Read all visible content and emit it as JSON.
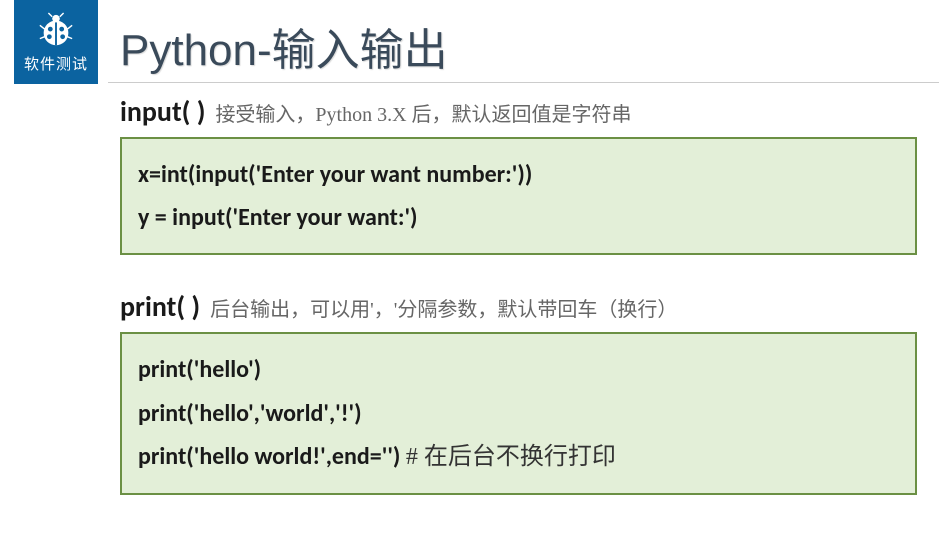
{
  "logo": {
    "text": "软件测试"
  },
  "title": "Python-输入输出",
  "section1": {
    "funcName": "input( )",
    "funcDesc": "接受输入，Python 3.X 后，默认返回值是字符串",
    "code": {
      "line1": "x=int(input('Enter your want number:'))",
      "line2": "y = input('Enter your want:')"
    }
  },
  "section2": {
    "funcName": "print( )",
    "funcDesc": "后台输出，可以用'，'分隔参数，默认带回车（换行）",
    "code": {
      "line1": "print('hello')",
      "line2": "print('hello','world','!')",
      "line3a": "print('hello world!',end='')  ",
      "line3b": "# 在后台不换行打印"
    }
  }
}
